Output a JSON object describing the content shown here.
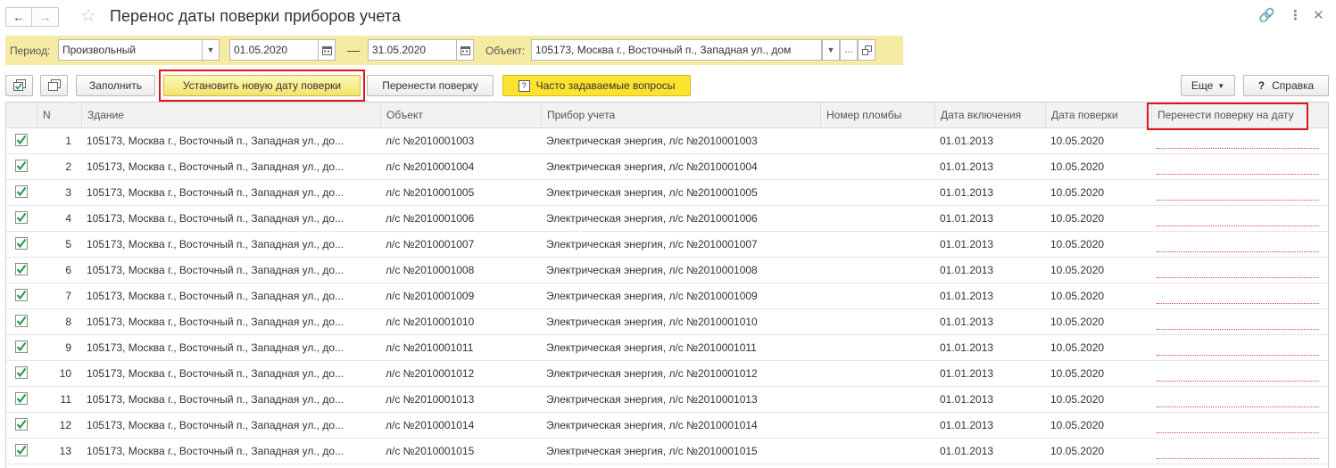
{
  "window": {
    "title": "Перенос даты поверки приборов учета"
  },
  "filters": {
    "period_label": "Период:",
    "period_value": "Произвольный",
    "date_from": "01.05.2020",
    "dash": "—",
    "date_to": "31.05.2020",
    "object_label": "Объект:",
    "object_value": "105173, Москва г., Восточный п., Западная ул., дом",
    "more": "..."
  },
  "toolbar": {
    "fill_label": "Заполнить",
    "set_date_label": "Установить новую дату поверки",
    "move_label": "Перенести поверку",
    "faq_label": "Часто задаваемые вопросы",
    "more_label": "Еще",
    "help_label": "Справка"
  },
  "table": {
    "columns": {
      "n": "N",
      "building": "Здание",
      "object": "Объект",
      "device": "Прибор учета",
      "seal": "Номер пломбы",
      "on_date": "Дата включения",
      "check_date": "Дата поверки",
      "move_to": "Перенести поверку на дату"
    },
    "rows": [
      {
        "n": "1",
        "building": "105173, Москва г., Восточный п., Западная ул., до...",
        "object": "л/с №2010001003",
        "device": "Электрическая энергия, л/с №2010001003",
        "seal": "",
        "on_date": "01.01.2013",
        "check_date": "10.05.2020"
      },
      {
        "n": "2",
        "building": "105173, Москва г., Восточный п., Западная ул., до...",
        "object": "л/с №2010001004",
        "device": "Электрическая энергия, л/с №2010001004",
        "seal": "",
        "on_date": "01.01.2013",
        "check_date": "10.05.2020"
      },
      {
        "n": "3",
        "building": "105173, Москва г., Восточный п., Западная ул., до...",
        "object": "л/с №2010001005",
        "device": "Электрическая энергия, л/с №2010001005",
        "seal": "",
        "on_date": "01.01.2013",
        "check_date": "10.05.2020"
      },
      {
        "n": "4",
        "building": "105173, Москва г., Восточный п., Западная ул., до...",
        "object": "л/с №2010001006",
        "device": "Электрическая энергия, л/с №2010001006",
        "seal": "",
        "on_date": "01.01.2013",
        "check_date": "10.05.2020"
      },
      {
        "n": "5",
        "building": "105173, Москва г., Восточный п., Западная ул., до...",
        "object": "л/с №2010001007",
        "device": "Электрическая энергия, л/с №2010001007",
        "seal": "",
        "on_date": "01.01.2013",
        "check_date": "10.05.2020"
      },
      {
        "n": "6",
        "building": "105173, Москва г., Восточный п., Западная ул., до...",
        "object": "л/с №2010001008",
        "device": "Электрическая энергия, л/с №2010001008",
        "seal": "",
        "on_date": "01.01.2013",
        "check_date": "10.05.2020"
      },
      {
        "n": "7",
        "building": "105173, Москва г., Восточный п., Западная ул., до...",
        "object": "л/с №2010001009",
        "device": "Электрическая энергия, л/с №2010001009",
        "seal": "",
        "on_date": "01.01.2013",
        "check_date": "10.05.2020"
      },
      {
        "n": "8",
        "building": "105173, Москва г., Восточный п., Западная ул., до...",
        "object": "л/с №2010001010",
        "device": "Электрическая энергия, л/с №2010001010",
        "seal": "",
        "on_date": "01.01.2013",
        "check_date": "10.05.2020"
      },
      {
        "n": "9",
        "building": "105173, Москва г., Восточный п., Западная ул., до...",
        "object": "л/с №2010001011",
        "device": "Электрическая энергия, л/с №2010001011",
        "seal": "",
        "on_date": "01.01.2013",
        "check_date": "10.05.2020"
      },
      {
        "n": "10",
        "building": "105173, Москва г., Восточный п., Западная ул., до...",
        "object": "л/с №2010001012",
        "device": "Электрическая энергия, л/с №2010001012",
        "seal": "",
        "on_date": "01.01.2013",
        "check_date": "10.05.2020"
      },
      {
        "n": "11",
        "building": "105173, Москва г., Восточный п., Западная ул., до...",
        "object": "л/с №2010001013",
        "device": "Электрическая энергия, л/с №2010001013",
        "seal": "",
        "on_date": "01.01.2013",
        "check_date": "10.05.2020"
      },
      {
        "n": "12",
        "building": "105173, Москва г., Восточный п., Западная ул., до...",
        "object": "л/с №2010001014",
        "device": "Электрическая энергия, л/с №2010001014",
        "seal": "",
        "on_date": "01.01.2013",
        "check_date": "10.05.2020"
      },
      {
        "n": "13",
        "building": "105173, Москва г., Восточный п., Западная ул., до...",
        "object": "л/с №2010001015",
        "device": "Электрическая энергия, л/с №2010001015",
        "seal": "",
        "on_date": "01.01.2013",
        "check_date": "10.05.2020"
      }
    ]
  },
  "colors": {
    "filter_bg": "#f6eba3",
    "primary_button": "#f4e46a",
    "faq_button": "#fde330",
    "highlight": "#e0151a",
    "check": "#2e9e4f"
  },
  "icons": {
    "back": "arrow-left-icon",
    "forward": "arrow-right-icon",
    "favorite": "star-icon",
    "link": "link-icon",
    "menu": "vertical-dots-icon",
    "close": "close-icon",
    "calendar": "calendar-icon",
    "dropdown": "chevron-down-icon",
    "open": "open-window-icon",
    "check_all": "check-all-icon",
    "copy": "copy-icon",
    "help": "question-icon"
  }
}
